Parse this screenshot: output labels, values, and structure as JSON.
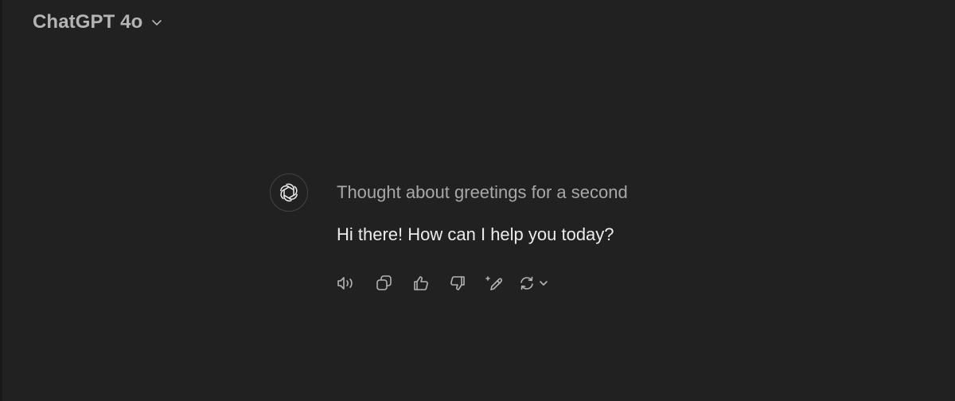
{
  "header": {
    "model_name": "ChatGPT 4o",
    "chevron_icon": "chevron-down-icon"
  },
  "message": {
    "avatar_icon": "openai-logo-icon",
    "thought_label": "Thought about greetings for a second",
    "reply_text": "Hi there! How can I help you today?"
  },
  "actions": [
    {
      "name": "read-aloud",
      "icon": "speaker-icon"
    },
    {
      "name": "copy",
      "icon": "copy-icon"
    },
    {
      "name": "good-response",
      "icon": "thumbs-up-icon"
    },
    {
      "name": "bad-response",
      "icon": "thumbs-down-icon"
    },
    {
      "name": "edit-in-canvas",
      "icon": "pencil-sparkle-icon"
    },
    {
      "name": "regenerate",
      "icon": "refresh-icon"
    }
  ],
  "colors": {
    "background": "#212121",
    "text_primary": "#ececec",
    "text_secondary": "#a8a8a8",
    "icon": "#b4b4b4"
  }
}
